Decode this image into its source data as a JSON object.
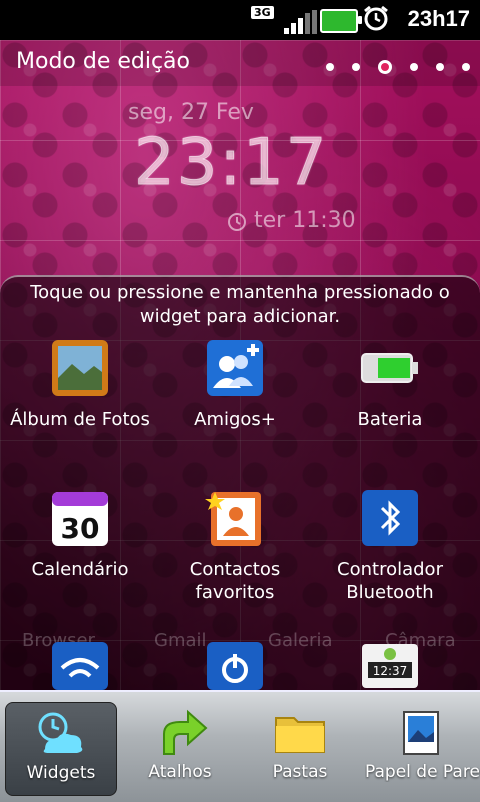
{
  "status_bar": {
    "network": "3G",
    "time": "23h17",
    "battery_color": "#2eb82e"
  },
  "header": {
    "title": "Modo de edição",
    "page_count": 6,
    "active_page": 3
  },
  "clock_widget": {
    "date": "seg, 27 Fev",
    "time": "23:17",
    "alarm": "ter 11:30"
  },
  "drawer": {
    "hint": "Toque ou pressione e mantenha pressionado o widget para adicionar.",
    "items": [
      {
        "label": "Álbum de Fotos",
        "icon": "photo-album-icon"
      },
      {
        "label": "Amigos+",
        "icon": "contacts-plus-icon"
      },
      {
        "label": "Bateria",
        "icon": "battery-icon"
      },
      {
        "label": "Calendário",
        "icon": "calendar-icon",
        "icon_text": "30"
      },
      {
        "label": "Contactos favoritos",
        "icon": "favorite-contacts-icon"
      },
      {
        "label": "Controlador Bluetooth",
        "icon": "bluetooth-icon"
      }
    ],
    "partial_items": [
      {
        "icon": "wifi-icon"
      },
      {
        "icon": "power-icon"
      },
      {
        "icon": "clock-android-icon",
        "icon_text": "12:37"
      }
    ],
    "background_apps": [
      "Browser",
      "Gmail",
      "Galeria",
      "Câmara"
    ]
  },
  "tabs": [
    {
      "label": "Widgets",
      "icon": "weather-clock-icon",
      "active": true
    },
    {
      "label": "Atalhos",
      "icon": "shortcut-arrow-icon",
      "active": false
    },
    {
      "label": "Pastas",
      "icon": "folder-icon",
      "active": false
    },
    {
      "label": "Papel de Parede",
      "icon": "wallpaper-icon",
      "active": false
    }
  ]
}
